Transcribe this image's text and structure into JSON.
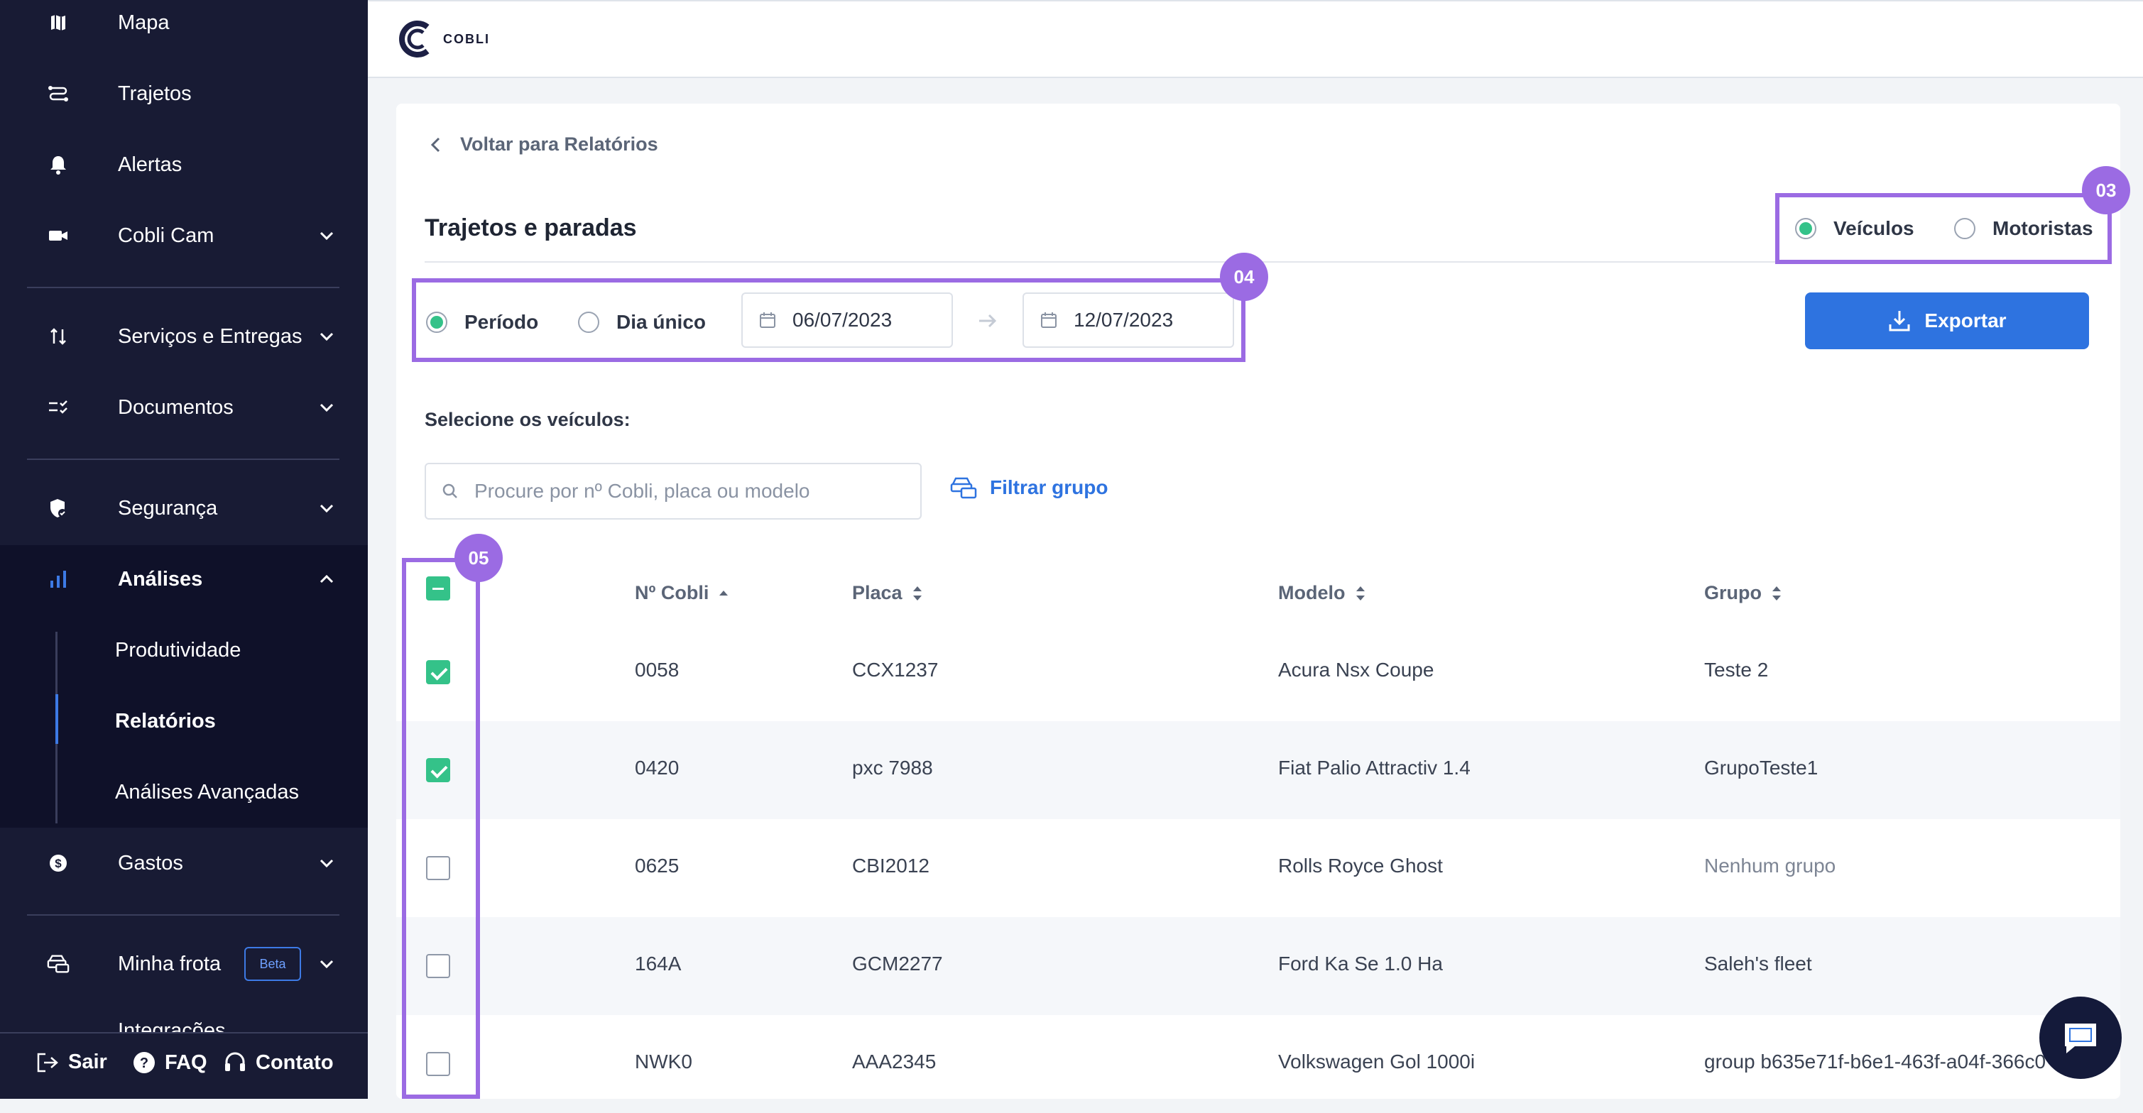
{
  "sidebar": {
    "items": [
      {
        "label": "Mapa",
        "icon": "map-icon"
      },
      {
        "label": "Trajetos",
        "icon": "route-icon"
      },
      {
        "label": "Alertas",
        "icon": "bell-icon"
      },
      {
        "label": "Cobli Cam",
        "icon": "camera-icon"
      },
      {
        "label": "Serviços e Entregas",
        "icon": "delivery-icon"
      },
      {
        "label": "Documentos",
        "icon": "checklist-icon"
      },
      {
        "label": "Segurança",
        "icon": "shield-icon"
      },
      {
        "label": "Análises",
        "icon": "chart-icon"
      },
      {
        "label": "Gastos",
        "icon": "dollar-icon"
      },
      {
        "label": "Minha frota",
        "icon": "fleet-icon"
      }
    ],
    "sub_items": [
      "Produtividade",
      "Relatórios",
      "Análises Avançadas"
    ],
    "beta_label": "Beta",
    "partial_item": "Integrações",
    "bottom": {
      "logout": "Sair",
      "faq": "FAQ",
      "contact": "Contato"
    }
  },
  "header": {
    "logo_text": "COBLI"
  },
  "page": {
    "back_label": "Voltar para Relatórios",
    "title": "Trajetos e paradas",
    "entity_options": [
      "Veículos",
      "Motoristas"
    ],
    "period_options": [
      "Período",
      "Dia único"
    ],
    "date_start": "06/07/2023",
    "date_end": "12/07/2023",
    "export_label": "Exportar",
    "select_label": "Selecione os veículos:",
    "search_placeholder": "Procure por nº Cobli, placa ou modelo",
    "filter_label": "Filtrar grupo"
  },
  "table": {
    "headers": [
      "Nº Cobli",
      "Placa",
      "Modelo",
      "Grupo"
    ],
    "rows": [
      {
        "cobli": "0058",
        "placa": "CCX1237",
        "modelo": "Acura Nsx Coupe",
        "grupo": "Teste 2",
        "checked": true
      },
      {
        "cobli": "0420",
        "placa": "pxc 7988",
        "modelo": "Fiat Palio Attractiv 1.4",
        "grupo": "GrupoTeste1",
        "checked": true
      },
      {
        "cobli": "0625",
        "placa": "CBI2012",
        "modelo": "Rolls Royce Ghost",
        "grupo": "Nenhum grupo",
        "checked": false
      },
      {
        "cobli": "164A",
        "placa": "GCM2277",
        "modelo": "Ford Ka Se 1.0 Ha",
        "grupo": "Saleh's fleet",
        "checked": false
      },
      {
        "cobli": "NWK0",
        "placa": "AAA2345",
        "modelo": "Volkswagen Gol 1000i",
        "grupo": "group b635e71f-b6e1-463f-a04f-366c0",
        "checked": false
      }
    ]
  },
  "annotations": [
    "03",
    "04",
    "05"
  ],
  "colors": {
    "sidebar": "#181b34",
    "accent": "#2e73e0",
    "green": "#34c289",
    "annotation": "#9b6be3"
  }
}
